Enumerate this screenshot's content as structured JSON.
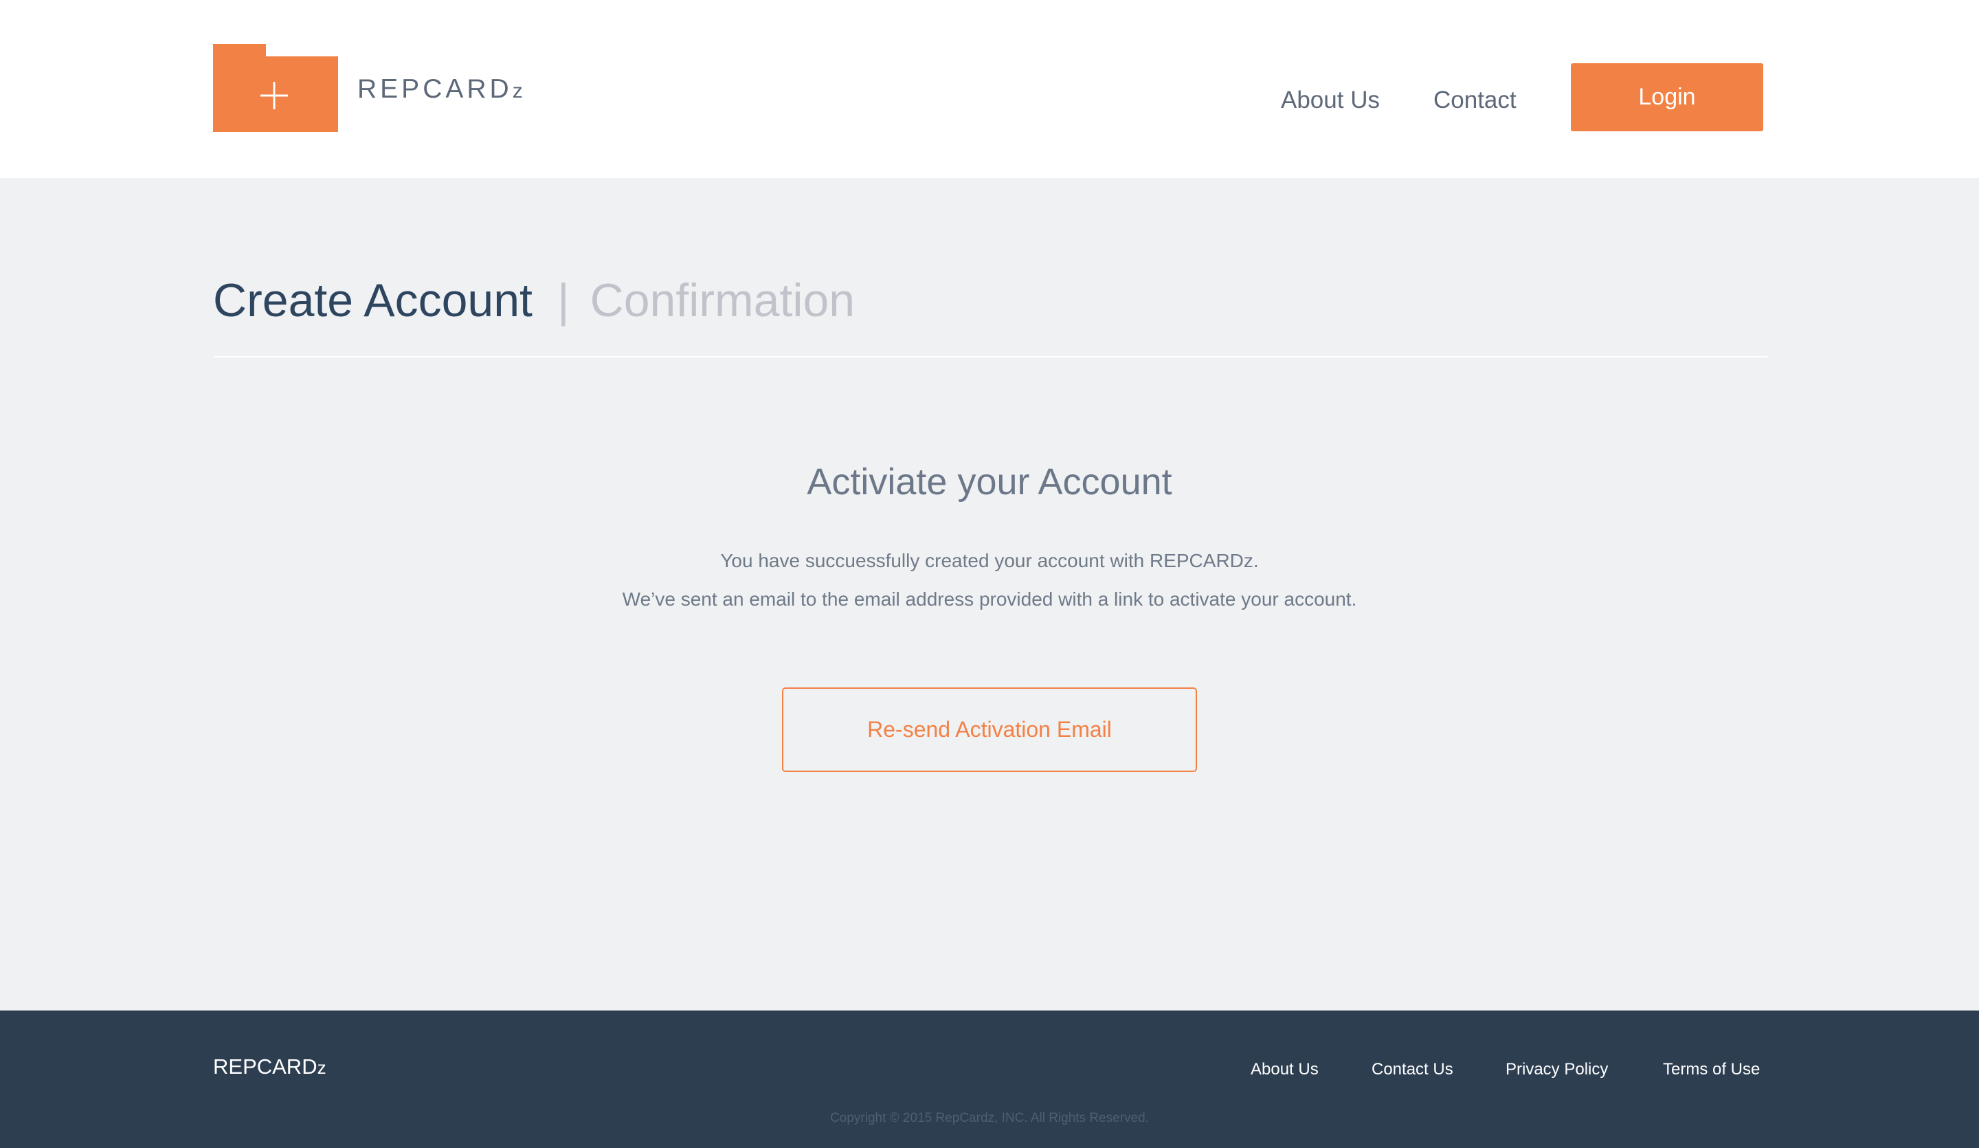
{
  "brand": {
    "name_main": "REPCARD",
    "name_suffix": "z",
    "accent_color": "#f28145"
  },
  "header": {
    "nav": {
      "about": "About Us",
      "contact": "Contact"
    },
    "login_label": "Login"
  },
  "steps": {
    "active": "Create Account",
    "separator": "|",
    "inactive": "Confirmation"
  },
  "main": {
    "title": "Activiate your Account",
    "line1": "You have succuessfully created your account with REPCARDz.",
    "line2": "We’ve sent an email to the email address provided with a link to activate your account.",
    "resend_label": "Re-send Activation Email"
  },
  "footer": {
    "brand_main": "REPCARD",
    "brand_suffix": "z",
    "links": {
      "about": "About Us",
      "contact": "Contact Us",
      "privacy": "Privacy Policy",
      "terms": "Terms of Use"
    },
    "copyright": "Copyright © 2015 RepCardz, INC. All Rights Reserved.",
    "background_color": "#2d3e51"
  }
}
